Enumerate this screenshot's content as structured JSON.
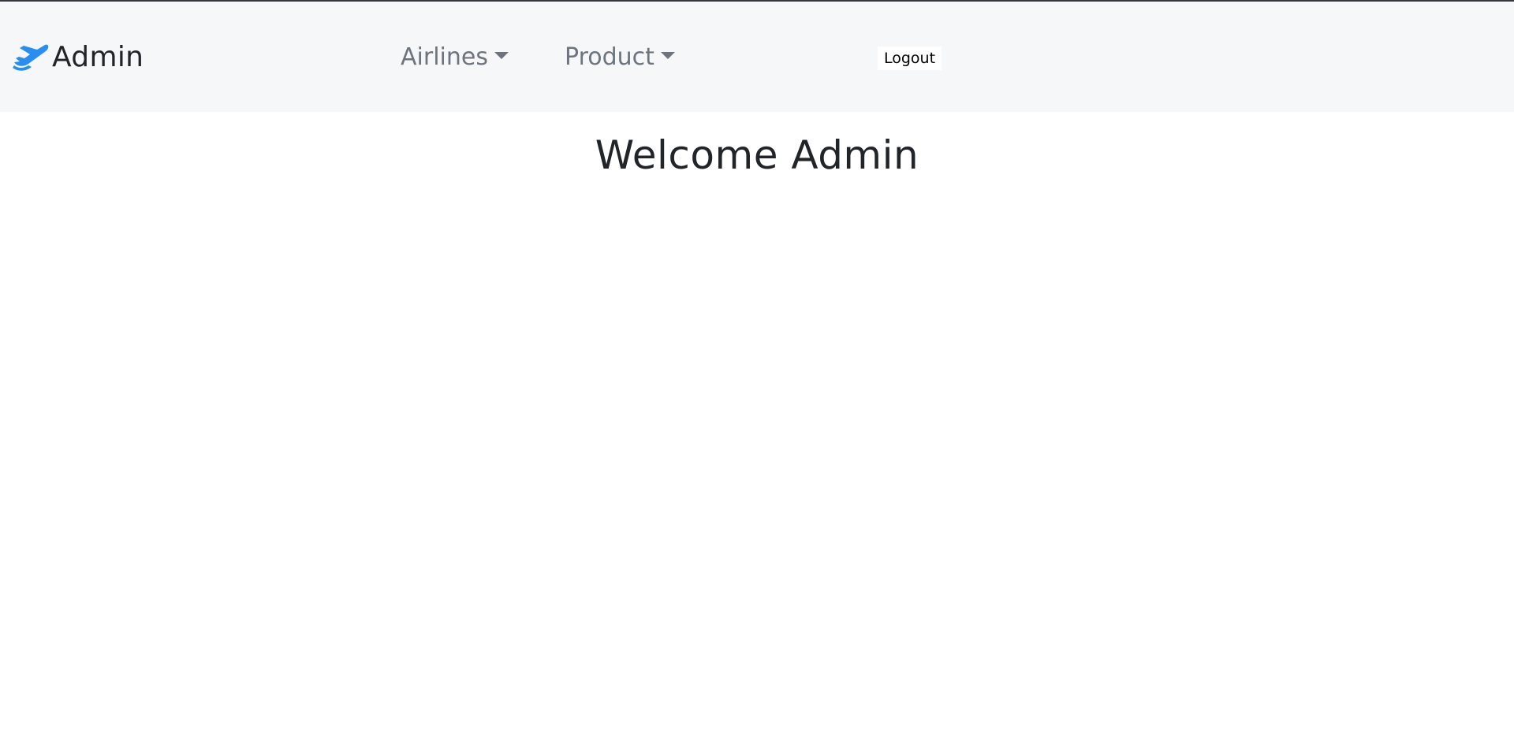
{
  "navbar": {
    "brand": {
      "icon": "airplane-departure-icon",
      "label": "Admin",
      "icon_color": "#2a8ef0"
    },
    "menus": [
      {
        "label": "Airlines",
        "icon": "caret-down-icon"
      },
      {
        "label": "Product",
        "icon": "caret-down-icon"
      }
    ],
    "logout_label": "Logout"
  },
  "main": {
    "heading": "Welcome Admin"
  },
  "colors": {
    "navbar_bg": "#f6f7f9",
    "nav_text": "#6c757d",
    "heading_text": "#212529",
    "top_edge": "#343a40"
  }
}
